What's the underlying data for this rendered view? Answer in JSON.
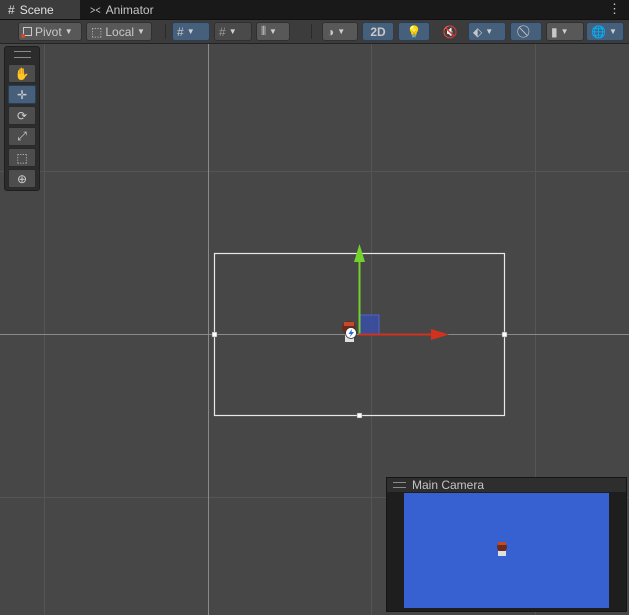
{
  "tabs": [
    {
      "label": "Scene",
      "icon": "grid-icon",
      "active": true
    },
    {
      "label": "Animator",
      "icon": "animator-icon",
      "active": false
    }
  ],
  "toolbar": {
    "pivot_label": "Pivot",
    "local_label": "Local",
    "mode_2d_label": "2D"
  },
  "tools": [
    "hand-tool",
    "move-tool",
    "rotate-tool",
    "scale-tool",
    "rect-tool",
    "transform-tool"
  ],
  "active_tool": "move-tool",
  "camera_preview": {
    "title": "Main Camera",
    "background_color": "#3761d1"
  },
  "colors": {
    "scene_bg": "#474747",
    "grid_line": "#555555",
    "grid_major": "#8a8a8a",
    "selection_active": "#46607c",
    "axis_x": "#d2311d",
    "axis_y": "#72d12b"
  }
}
